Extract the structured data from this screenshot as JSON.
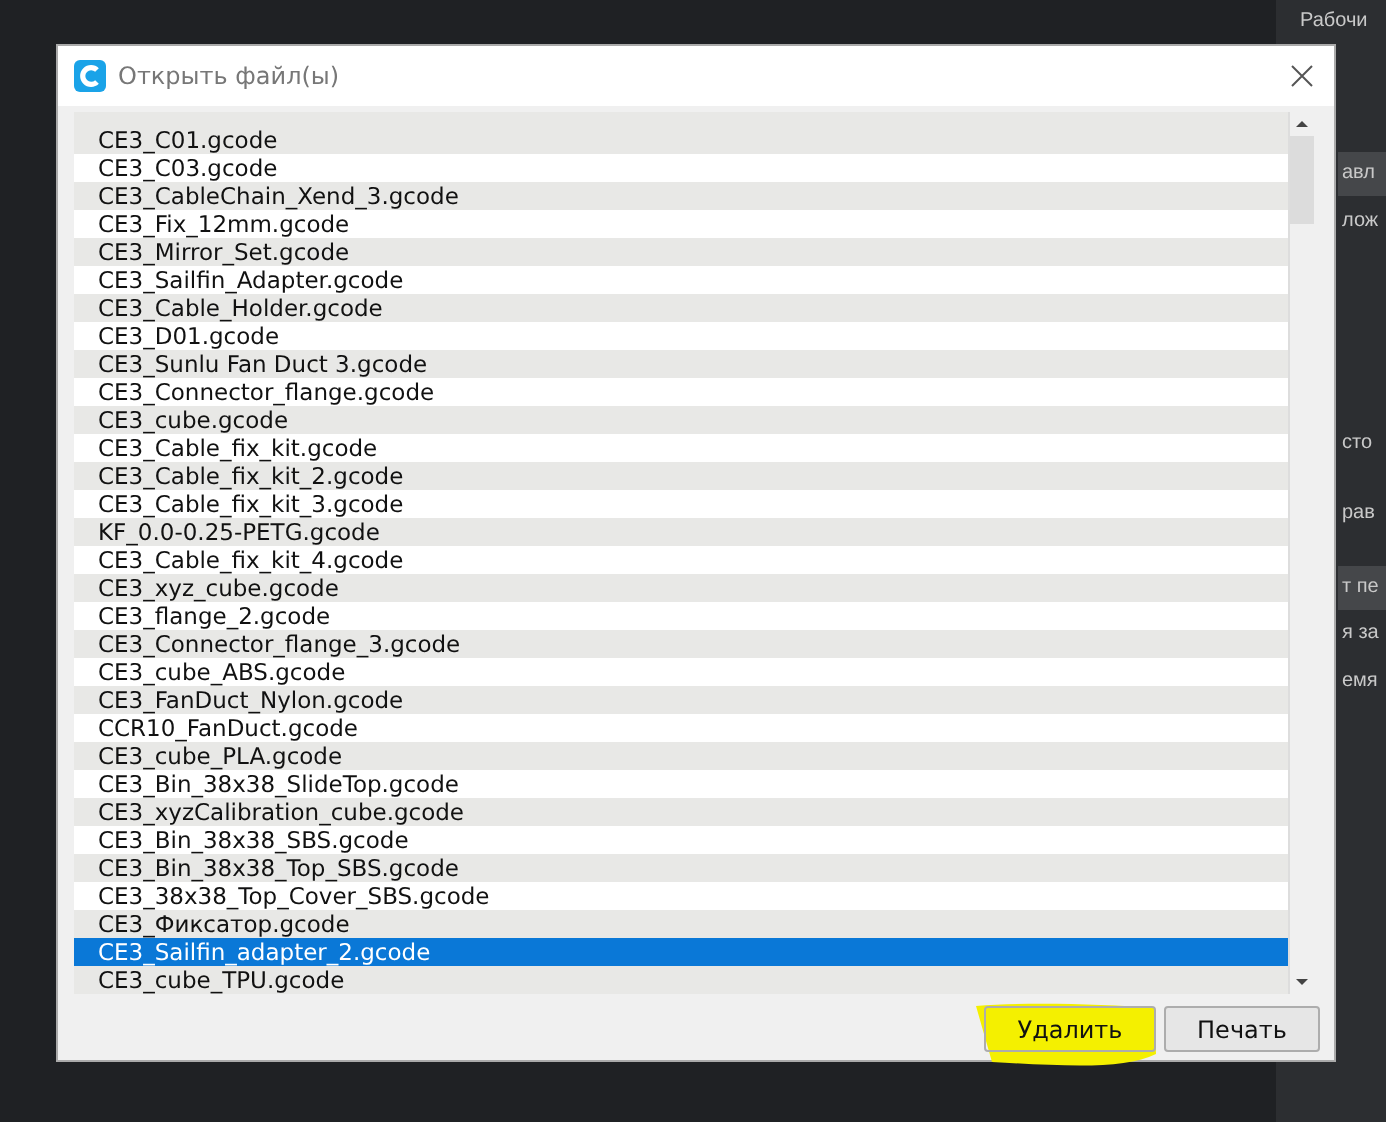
{
  "background_panel": {
    "heading": "Рабочи",
    "items": [
      {
        "label": "авл",
        "highlighted": true
      },
      {
        "label": "лож",
        "highlighted": false
      },
      {
        "label": "сто",
        "highlighted": false
      },
      {
        "label": "рав",
        "highlighted": false
      },
      {
        "label": "т пе",
        "highlighted": true
      },
      {
        "label": "я за",
        "highlighted": false
      },
      {
        "label": "емя",
        "highlighted": false
      }
    ]
  },
  "dialog": {
    "title": "Открыть файл(ы)",
    "files": [
      {
        "name": "CE3_C01.gcode",
        "selected": false
      },
      {
        "name": "CE3_C03.gcode",
        "selected": false
      },
      {
        "name": "CE3_CableChain_Xend_3.gcode",
        "selected": false
      },
      {
        "name": "CE3_Fix_12mm.gcode",
        "selected": false
      },
      {
        "name": "CE3_Mirror_Set.gcode",
        "selected": false
      },
      {
        "name": "CE3_Sailfin_Adapter.gcode",
        "selected": false
      },
      {
        "name": "CE3_Cable_Holder.gcode",
        "selected": false
      },
      {
        "name": "CE3_D01.gcode",
        "selected": false
      },
      {
        "name": "CE3_Sunlu Fan Duct 3.gcode",
        "selected": false
      },
      {
        "name": "CE3_Connector_flange.gcode",
        "selected": false
      },
      {
        "name": "CE3_cube.gcode",
        "selected": false
      },
      {
        "name": "CE3_Cable_fix_kit.gcode",
        "selected": false
      },
      {
        "name": "CE3_Cable_fix_kit_2.gcode",
        "selected": false
      },
      {
        "name": "CE3_Cable_fix_kit_3.gcode",
        "selected": false
      },
      {
        "name": "KF_0.0-0.25-PETG.gcode",
        "selected": false
      },
      {
        "name": "CE3_Cable_fix_kit_4.gcode",
        "selected": false
      },
      {
        "name": "CE3_xyz_cube.gcode",
        "selected": false
      },
      {
        "name": "CE3_flange_2.gcode",
        "selected": false
      },
      {
        "name": "CE3_Connector_flange_3.gcode",
        "selected": false
      },
      {
        "name": "CE3_cube_ABS.gcode",
        "selected": false
      },
      {
        "name": "CE3_FanDuct_Nylon.gcode",
        "selected": false
      },
      {
        "name": "CCR10_FanDuct.gcode",
        "selected": false
      },
      {
        "name": "CE3_cube_PLA.gcode",
        "selected": false
      },
      {
        "name": "CE3_Bin_38x38_SlideTop.gcode",
        "selected": false
      },
      {
        "name": "CE3_xyzCalibration_cube.gcode",
        "selected": false
      },
      {
        "name": "CE3_Bin_38x38_SBS.gcode",
        "selected": false
      },
      {
        "name": "CE3_Bin_38x38_Top_SBS.gcode",
        "selected": false
      },
      {
        "name": "CE3_38x38_Top_Cover_SBS.gcode",
        "selected": false
      },
      {
        "name": "CE3_Фиксатор.gcode",
        "selected": false
      },
      {
        "name": "CE3_Sailfin_adapter_2.gcode",
        "selected": true
      },
      {
        "name": "CE3_cube_TPU.gcode",
        "selected": false
      }
    ],
    "buttons": [
      {
        "label": "Удалить",
        "highlighted": true
      },
      {
        "label": "Печать",
        "highlighted": false
      }
    ]
  }
}
